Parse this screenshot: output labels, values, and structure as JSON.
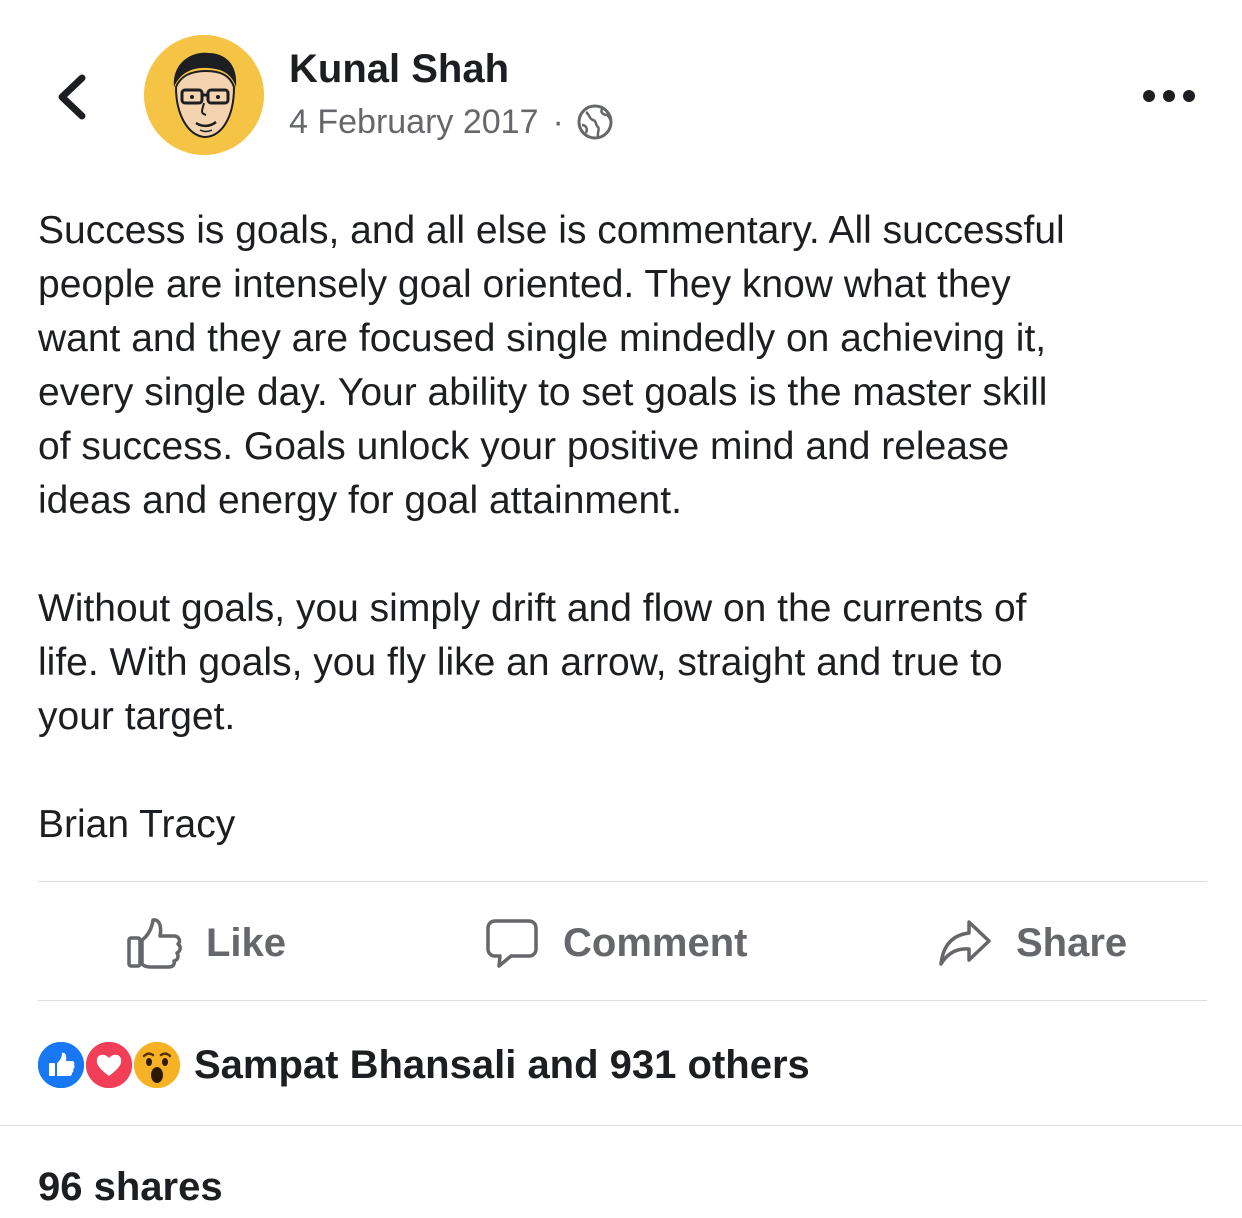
{
  "header": {
    "back_icon": "chevron-left-icon",
    "author_name": "Kunal Shah",
    "timestamp": "4 February 2017",
    "separator": "·",
    "privacy_icon": "globe-icon",
    "more_icon": "more-horizontal-icon"
  },
  "post": {
    "paragraphs": [
      "Success is goals, and all else is commentary. All successful\npeople are intensely goal oriented. They know what they\nwant and they are focused single mindedly on achieving it,\nevery single day. Your ability to set goals is the master skill\nof success. Goals unlock your positive mind and release\nideas and energy for goal attainment.",
      "Without goals, you simply drift and flow on the currents of\nlife. With goals, you fly like an arrow, straight and true to\nyour target.",
      "Brian Tracy"
    ]
  },
  "actions": {
    "like_label": "Like",
    "comment_label": "Comment",
    "share_label": "Share"
  },
  "reactions": {
    "types": [
      "like",
      "love",
      "wow"
    ],
    "summary": "Sampat Bhansali and 931 others"
  },
  "shares": {
    "label": "96 shares"
  },
  "colors": {
    "avatar_bg": "#f6c445",
    "like_blue": "#1877f2",
    "love_red": "#f33e58",
    "wow_yellow": "#f7b125",
    "secondary_text": "#65676b",
    "divider": "#dadde1"
  }
}
